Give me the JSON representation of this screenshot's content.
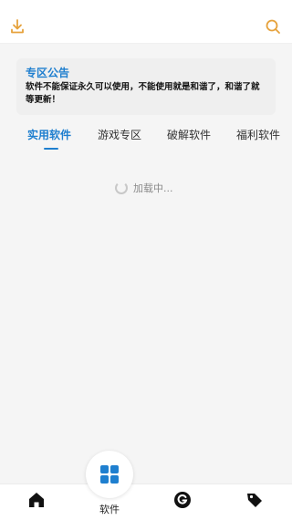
{
  "header": {
    "download_icon": "download-icon",
    "search_icon": "search-icon"
  },
  "notice": {
    "title": "专区公告",
    "body": "软件不能保证永久可以使用，不能使用就是和谐了，和谐了就等更新！"
  },
  "tabs": [
    {
      "label": "实用软件",
      "active": true
    },
    {
      "label": "游戏专区",
      "active": false
    },
    {
      "label": "破解软件",
      "active": false
    },
    {
      "label": "福利软件",
      "active": false
    }
  ],
  "loading": {
    "text": "加载中..."
  },
  "bottom_nav": {
    "center_label": "软件",
    "items": [
      "home-icon",
      "apps-grid-icon",
      "g-icon",
      "tag-icon"
    ]
  },
  "colors": {
    "accent": "#1f7fcf",
    "header_icon": "#e6a23c",
    "background": "#f5f5f5"
  }
}
